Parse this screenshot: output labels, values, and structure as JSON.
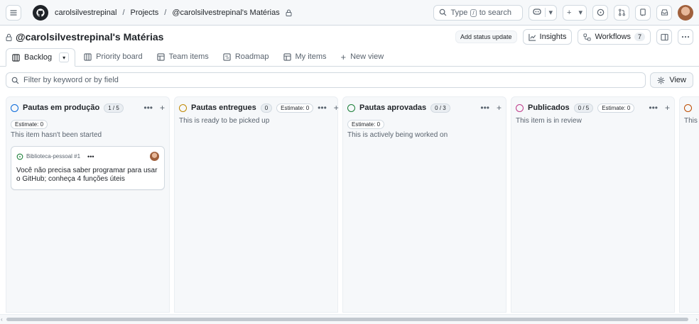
{
  "header": {
    "breadcrumbs": [
      "carolsilvestrepinal",
      "Projects",
      "@carolsilvestrepinal's Matérias"
    ],
    "separator": "/",
    "search_placeholder_prefix": "Type",
    "search_key": "/",
    "search_placeholder_suffix": "to search"
  },
  "project": {
    "title": "@carolsilvestrepinal's Matérias",
    "add_status_update": "Add status update",
    "insights": "Insights",
    "workflows": "Workflows",
    "workflows_count": "7"
  },
  "tabs": [
    {
      "label": "Backlog",
      "icon": "board-icon",
      "active": true
    },
    {
      "label": "Priority board",
      "icon": "board-icon"
    },
    {
      "label": "Team items",
      "icon": "table-icon"
    },
    {
      "label": "Roadmap",
      "icon": "roadmap-icon"
    },
    {
      "label": "My items",
      "icon": "table-icon"
    },
    {
      "label": "New view",
      "icon": "plus-icon"
    }
  ],
  "filter": {
    "placeholder": "Filter by keyword or by field",
    "view_label": "View"
  },
  "columns": [
    {
      "name": "Pautas em produção",
      "count": "1 / 5",
      "color": "#0969da",
      "estimate": "Estimate: 0",
      "description": "This item hasn't been started",
      "cards": [
        {
          "repo": "Biblioteca-pessoal #1",
          "title": "Você não precisa saber programar para usar o GitHub; conheça 4 funções úteis"
        }
      ]
    },
    {
      "name": "Pautas entregues",
      "count": "0",
      "color": "#bf8700",
      "estimate": "Estimate: 0",
      "description": "This is ready to be picked up"
    },
    {
      "name": "Pautas aprovadas",
      "count": "0 / 3",
      "color": "#1a7f37",
      "estimate": "Estimate: 0",
      "description": "This is actively being worked on"
    },
    {
      "name": "Publicados",
      "count": "0 / 5",
      "color": "#bf3989",
      "estimate": "Estimate: 0",
      "description": "This item is in review"
    },
    {
      "color": "#bc4c00",
      "description": "This"
    }
  ],
  "colors": {
    "border": "#d1d9e0",
    "muted": "#59636e",
    "canvas_subtle": "#f6f8fa"
  }
}
